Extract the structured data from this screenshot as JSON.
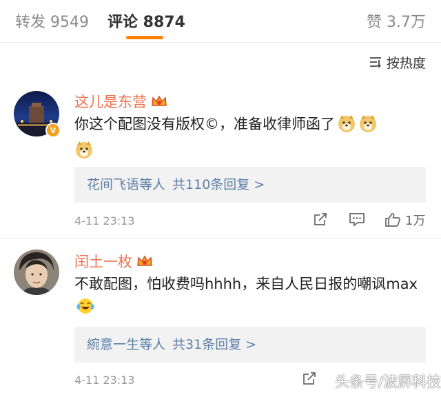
{
  "tabs": {
    "repost": "转发 9549",
    "comments": "评论 8874",
    "likes": "赞 3.7万"
  },
  "sort_label": "按热度",
  "comments": [
    {
      "username": "这儿是东营",
      "text": "你这个配图没有版权©，准备收律师函了",
      "reply_names": "花间飞语等人",
      "reply_count": "共110条回复 >",
      "time": "4-11 23:13",
      "like_count": "1万"
    },
    {
      "username": "闰土一枚",
      "text": "不敢配图，怕收费吗hhhh，来自人民日报的嘲讽max",
      "reply_names": "綩意一生等人",
      "reply_count": "共31条回复 >",
      "time": "4-11 23:13"
    }
  ],
  "watermark": "头条号/波屏科技",
  "colors": {
    "accent": "#ff8200",
    "username": "#eb7350",
    "link": "#5d7fa8"
  }
}
